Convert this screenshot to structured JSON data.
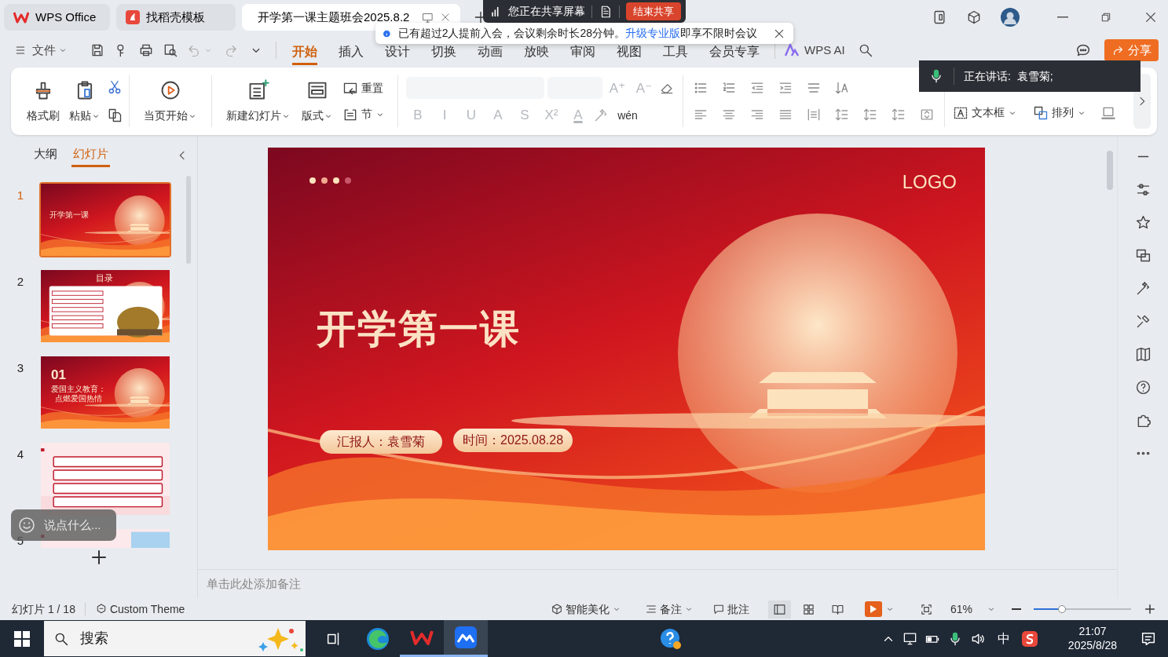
{
  "title_tabs": [
    {
      "label": "WPS Office",
      "kind": "home",
      "selected": false
    },
    {
      "label": "找稻壳模板",
      "kind": "template",
      "selected": false
    },
    {
      "label": "开学第一课主题班会2025.8.2",
      "kind": "document",
      "selected": true
    }
  ],
  "share_bar": {
    "label": "您正在共享屏幕",
    "stop_button": "结束共享"
  },
  "notice": {
    "text": "已有超过2人提前入会，会议剩余时长28分钟。",
    "link": "升级专业版",
    "tail": "即享不限时会议"
  },
  "menu": {
    "file": "文件",
    "tabs": [
      {
        "label": "开始",
        "selected": true
      },
      {
        "label": "插入",
        "selected": false
      },
      {
        "label": "设计",
        "selected": false
      },
      {
        "label": "切换",
        "selected": false
      },
      {
        "label": "动画",
        "selected": false
      },
      {
        "label": "放映",
        "selected": false
      },
      {
        "label": "审阅",
        "selected": false
      },
      {
        "label": "视图",
        "selected": false
      },
      {
        "label": "工具",
        "selected": false
      },
      {
        "label": "会员专享",
        "selected": false
      }
    ],
    "ai": "WPS AI",
    "share_button": "分享"
  },
  "speaking": {
    "label": "正在讲话:  袁雪菊;"
  },
  "ribbon": {
    "format_painter": "格式刷",
    "paste": "粘贴",
    "start_here": "当页开始",
    "new_slide": "新建幻灯片",
    "layout": "版式",
    "reset": "重置",
    "section": "节",
    "font_disabled": true,
    "font_buttons": [
      "B",
      "I",
      "U",
      "A",
      "S",
      "X²"
    ],
    "size_buttons": [
      "A⁺",
      "A⁻"
    ],
    "color_button": "A",
    "phonetic": "wén",
    "text_box": "文本框",
    "arrange": "排列"
  },
  "panel_tabs": [
    {
      "label": "大纲",
      "selected": false
    },
    {
      "label": "幻灯片",
      "selected": true
    }
  ],
  "slides": [
    {
      "number": "1",
      "kind": "cover",
      "selected": true,
      "title": "开学第一课"
    },
    {
      "number": "2",
      "kind": "contents",
      "selected": false,
      "title": "目录"
    },
    {
      "number": "3",
      "kind": "section",
      "selected": false,
      "index": "01",
      "title": "爱国主义教育：点燃爱国热情"
    },
    {
      "number": "4",
      "kind": "text",
      "selected": false
    },
    {
      "number": "5",
      "kind": "text_photo",
      "selected": false
    }
  ],
  "chat_bubble": {
    "placeholder": "说点什么..."
  },
  "slide": {
    "logo": "LOGO",
    "title": "开学第一课",
    "presenter": "汇报人：袁雪菊",
    "date": "时间：2025.08.28"
  },
  "notes": {
    "placeholder": "单击此处添加备注"
  },
  "status_bar": {
    "slide_counter": "幻灯片 1 / 18",
    "theme": "Custom Theme",
    "beautify": "智能美化",
    "notes": "备注",
    "comments": "批注",
    "zoom": "61%",
    "zoom_slider": {
      "level": 0.29
    }
  },
  "taskbar": {
    "search": {
      "placeholder": "搜索"
    },
    "ime": "中",
    "time": "21:07",
    "date": "2025/8/28"
  }
}
